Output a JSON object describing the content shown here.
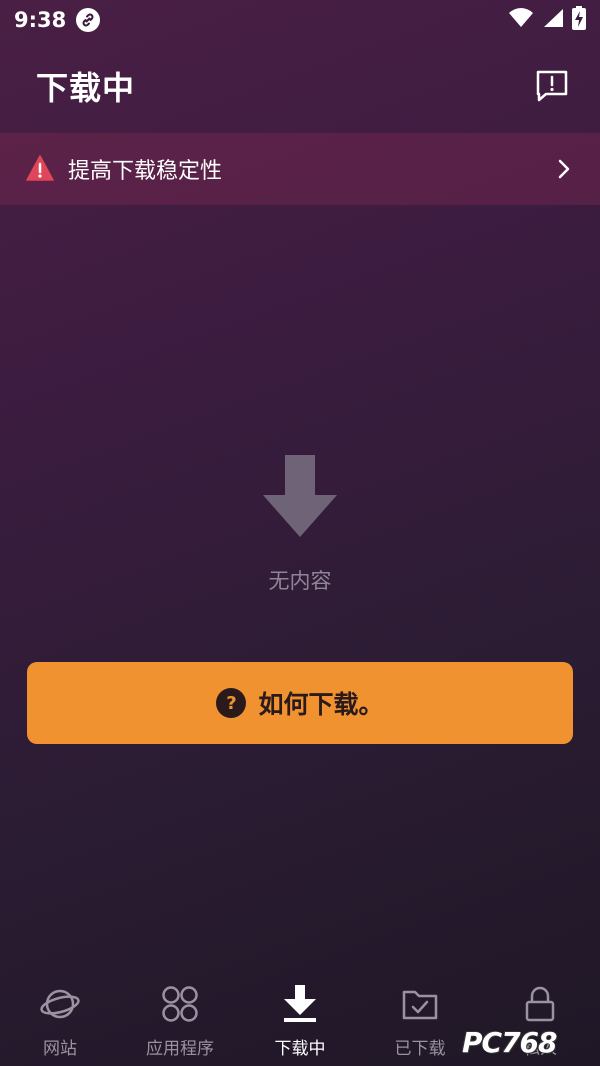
{
  "status_bar": {
    "time": "9:38",
    "icons": [
      "link-icon",
      "wifi-icon",
      "signal-icon",
      "battery-charging-icon"
    ]
  },
  "app_bar": {
    "title": "下载中",
    "action_icon": "feedback-icon"
  },
  "banner": {
    "icon": "warning-icon",
    "text": "提高下载稳定性",
    "chevron": "chevron-right-icon",
    "icon_color": "#e0455a"
  },
  "empty_state": {
    "icon": "download-arrow-icon",
    "text": "无内容"
  },
  "how_button": {
    "icon": "help-icon",
    "label": "如何下载。",
    "color": "#f0922f"
  },
  "bottom_nav": {
    "items": [
      {
        "label": "网站",
        "icon": "planet-icon",
        "active": false
      },
      {
        "label": "应用程序",
        "icon": "apps-grid-icon",
        "active": false
      },
      {
        "label": "下载中",
        "icon": "download-icon",
        "active": true
      },
      {
        "label": "已下载",
        "icon": "folder-check-icon",
        "active": false
      },
      {
        "label": "私人",
        "icon": "lock-icon",
        "active": false
      }
    ]
  },
  "watermark": {
    "text": "PC768"
  }
}
